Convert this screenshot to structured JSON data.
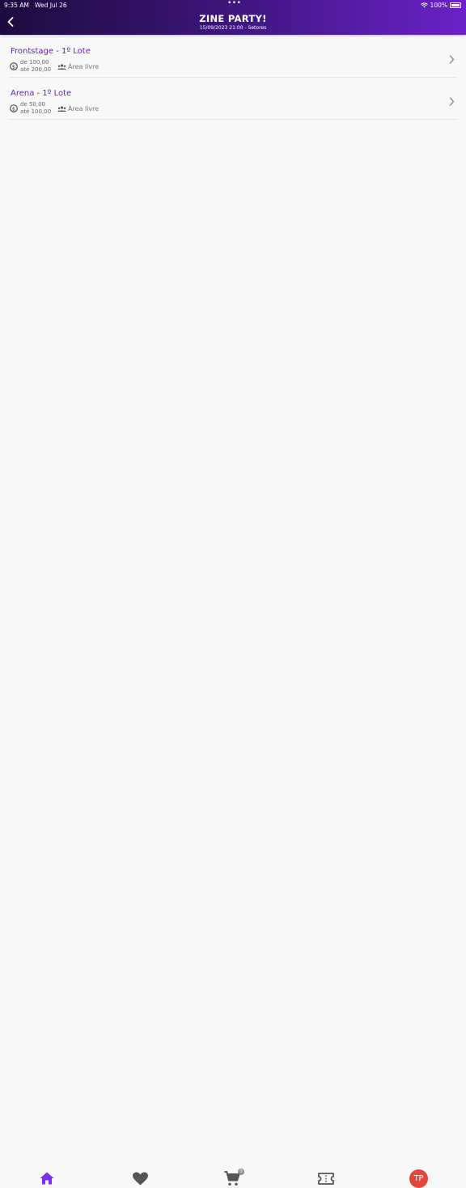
{
  "status_bar": {
    "time": "9:35 AM",
    "date": "Wed Jul 26",
    "dots": "•••",
    "battery": "100%"
  },
  "header": {
    "title": "ZINE PARTY!",
    "subtitle": "15/09/2023 21:00 - Setores"
  },
  "sectors": [
    {
      "name": "Frontstage - 1º Lote",
      "price_from": "de 100,00",
      "price_to": "até 200,00",
      "area": "Área livre"
    },
    {
      "name": "Arena - 1º Lote",
      "price_from": "de 50,00",
      "price_to": "até 100,00",
      "area": "Área livre"
    }
  ],
  "tabbar": {
    "items": [
      "home-icon",
      "heart-icon",
      "cart-icon",
      "ticket-icon",
      "avatar"
    ],
    "cart_count": "0",
    "avatar_initials": "TP"
  },
  "colors": {
    "accent": "#6a1fbf",
    "header_start": "#1d0b3d",
    "header_end": "#6a22c8",
    "tab_active": "#7b2ff0",
    "tab_inactive": "#555555",
    "avatar_bg": "#e2453c"
  }
}
